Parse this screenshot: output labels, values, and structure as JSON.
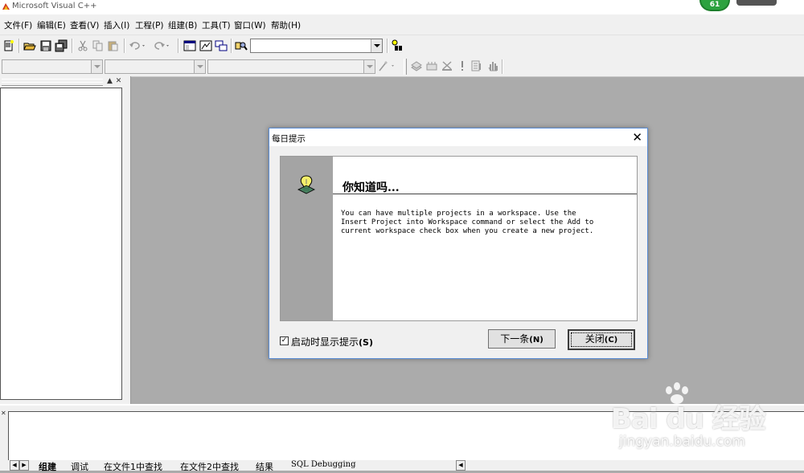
{
  "window": {
    "title": "Microsoft Visual C++"
  },
  "badge": {
    "count": "61"
  },
  "menu": {
    "items": [
      "文件(F)",
      "编辑(E)",
      "查看(V)",
      "插入(I)",
      "工程(P)",
      "组建(B)",
      "工具(T)",
      "窗口(W)",
      "帮助(H)"
    ]
  },
  "icons": {
    "toolbar1": [
      "new-file-icon",
      "open-folder-icon",
      "save-icon",
      "save-all-icon",
      "cut-icon",
      "copy-icon",
      "paste-icon",
      "undo-icon",
      "redo-icon",
      "workspace-icon",
      "output-icon",
      "window-list-icon",
      "find-in-files-icon",
      "search-icon"
    ],
    "toolbar2": [
      "wizard-icon",
      "compile-icon",
      "build-icon",
      "stop-build-icon",
      "execute-icon",
      "go-icon",
      "breakpoint-icon"
    ]
  },
  "dialog": {
    "title": "每日提示",
    "heading": "你知道吗...",
    "body": "You can have multiple projects in a workspace. Use the\nInsert Project into Workspace command or select the Add to\ncurrent workspace check box when you create a new project.",
    "checkbox_label": "启动时显示提示",
    "checkbox_key": "(S)",
    "checkbox_checked": true,
    "next_label": "下一条",
    "next_key": "(N)",
    "close_label": "关闭",
    "close_key": "(C)"
  },
  "output_tabs": [
    "组建",
    "调试",
    "在文件1中查找",
    "在文件2中查找",
    "结果",
    "SQL Debugging"
  ],
  "watermark": {
    "logo": "Bai du 经验",
    "url": "jingyan.baidu.com"
  }
}
